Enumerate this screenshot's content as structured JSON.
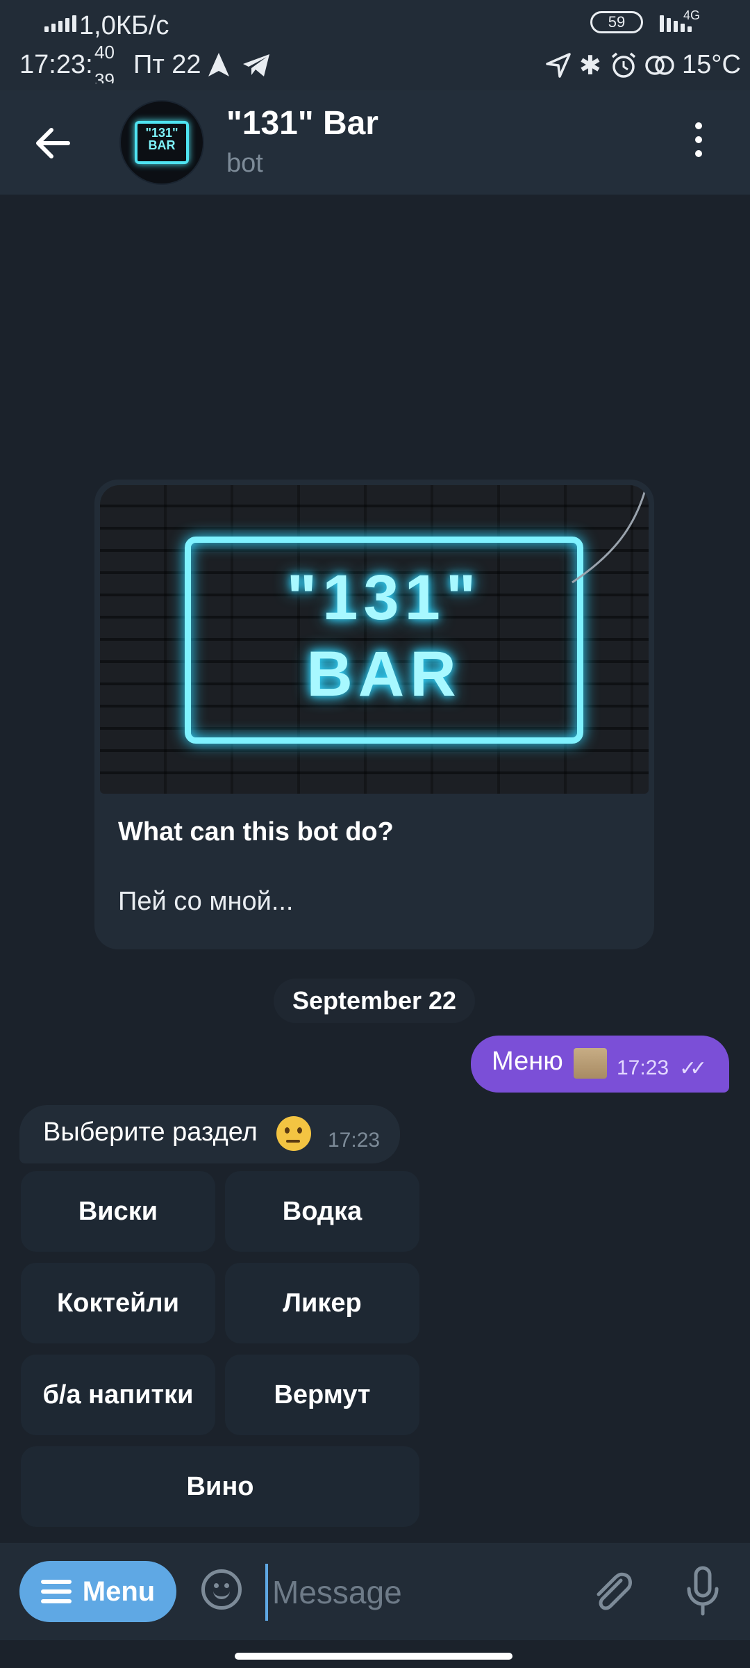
{
  "status_bar": {
    "speed": "1,0КБ/с",
    "time": "17:23:",
    "seconds_top": "40",
    "seconds_bottom": "39",
    "day": "Пт 22",
    "battery": "59",
    "network": "4G",
    "temperature": "15°C"
  },
  "header": {
    "title": "\"131\" Bar",
    "subtitle": "bot",
    "avatar_logo_top": "\"131\"",
    "avatar_logo_bottom": "BAR"
  },
  "bot_info": {
    "image_logo_top": "\"131\"",
    "image_logo_bottom": "BAR",
    "title": "What can this bot do?",
    "description": "Пей со мной..."
  },
  "date_divider": "September 22",
  "messages": [
    {
      "direction": "out",
      "text": "Меню",
      "emoji": "scroll-emoji",
      "time": "17:23",
      "status": "read"
    },
    {
      "direction": "in",
      "text": "Выберите раздел",
      "emoji": "thinking-face-emoji",
      "time": "17:23"
    }
  ],
  "keyboard": {
    "rows": [
      [
        "Виски",
        "Водка"
      ],
      [
        "Коктейли",
        "Ликер"
      ],
      [
        "б/а напитки",
        "Вермут"
      ],
      [
        "Вино"
      ]
    ]
  },
  "input_bar": {
    "menu_label": "Menu",
    "placeholder": "Message"
  },
  "colors": {
    "accent_blue": "#5fa8e4",
    "outgoing_bubble": "#7b4fd7",
    "neon": "#7ff2ff"
  }
}
